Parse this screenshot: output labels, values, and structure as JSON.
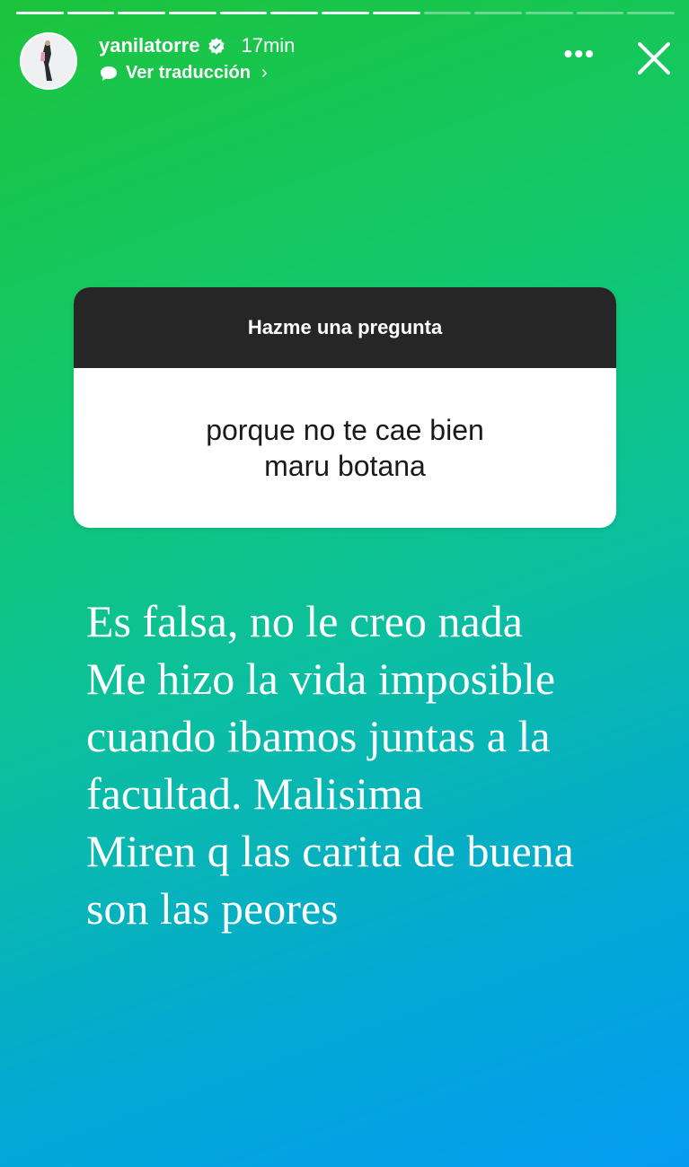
{
  "story": {
    "progress": {
      "segments_total": 13,
      "segments_done": 8
    },
    "header": {
      "username": "yanilatorre",
      "time": "17min",
      "translate_label": "Ver traducción",
      "translate_chevron": "›",
      "more_label": "•••"
    },
    "question_sticker": {
      "title": "Hazme una pregunta",
      "question": "porque no te cae bien\nmaru botana"
    },
    "answer_lines": [
      "Es falsa, no le creo nada",
      "Me hizo la vida imposible",
      "cuando ibamos juntas a la",
      "facultad. Malisima",
      "Miren q las carita de buena",
      "son las peores"
    ],
    "colors": {
      "gradient_start": "#1cc43c",
      "gradient_end": "#049cf2",
      "sticker_header": "#262626"
    },
    "icons": {
      "verified": "verified-badge-icon",
      "translate": "speech-bubble-icon",
      "more": "more-dots-icon",
      "close": "close-icon"
    }
  }
}
